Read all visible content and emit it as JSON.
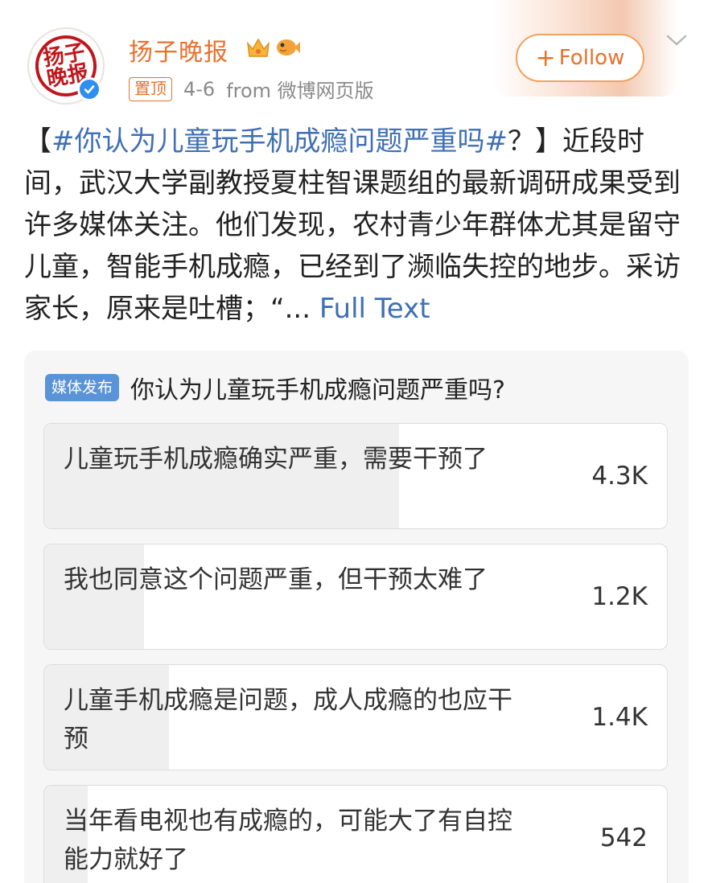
{
  "account": {
    "name": "扬子晚报",
    "avatar_text": "扬子晚报",
    "pin_label": "置顶",
    "date": "4-6",
    "source": "from 微博网页版",
    "follow_label": "Follow"
  },
  "post": {
    "open_bracket": "【",
    "hashtag": "#你认为儿童玩手机成瘾问题严重吗#",
    "after_hashtag": "？】近段时间，武汉大学副教授夏柱智课题组的最新调研成果受到许多媒体关注。他们发现，农村青少年群体尤其是留守儿童，智能手机成瘾，已经到了濒临失控的地步。采访家长，原来是吐槽；“...",
    "full_text_link": "Full Text"
  },
  "poll": {
    "tag": "媒体发布",
    "question": "你认为儿童玩手机成瘾问题严重吗?",
    "options": [
      {
        "label": "儿童玩手机成瘾确实严重，需要干预了",
        "count": "4.3K",
        "share": 0.57
      },
      {
        "label": "我也同意这个问题严重，但干预太难了",
        "count": "1.2K",
        "share": 0.16
      },
      {
        "label": "儿童手机成瘾是问题，成人成瘾的也应干预",
        "count": "1.4K",
        "share": 0.2
      },
      {
        "label": "当年看电视也有成瘾的，可能大了有自控能力就好了",
        "count": "542",
        "share": 0.07
      }
    ]
  },
  "icons": {
    "verified": "verified-check-icon",
    "crown_badge": "crown-badge-icon",
    "fish_badge": "fish-badge-icon",
    "chevron": "chevron-down-icon"
  },
  "colors": {
    "brand_orange": "#e8712b",
    "link_blue": "#3f6fb5",
    "verified_blue": "#2f8ff0",
    "media_tag_blue": "#5a93d6"
  }
}
